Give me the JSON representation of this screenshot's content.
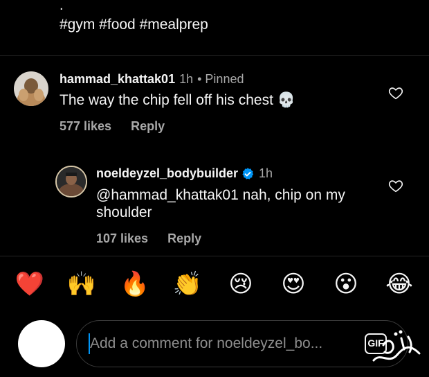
{
  "caption": {
    "dot": ".",
    "tags": "#gym #food #mealprep"
  },
  "comments": [
    {
      "username": "hammad_khattak01",
      "time": "1h",
      "pinned": "• Pinned",
      "text": "The way the chip fell off his chest 💀",
      "likes": "577 likes",
      "reply_label": "Reply"
    },
    {
      "username": "noeldeyzel_bodybuilder",
      "verified_icon": "verified-badge-icon",
      "time": "1h",
      "text": "@hammad_khattak01 nah, chip on my shoulder",
      "likes": "107 likes",
      "reply_label": "Reply"
    }
  ],
  "quick_reactions": [
    "❤️",
    "🙌",
    "🔥",
    "👏",
    "😢",
    "😍",
    "😮",
    "😂"
  ],
  "composer": {
    "placeholder": "Add a comment for noeldeyzel_bo...",
    "gif_label": "GIF"
  },
  "colors": {
    "background": "#000000",
    "text": "#f5f5f5",
    "secondary": "#a8a8a8",
    "verified": "#0095f6"
  }
}
